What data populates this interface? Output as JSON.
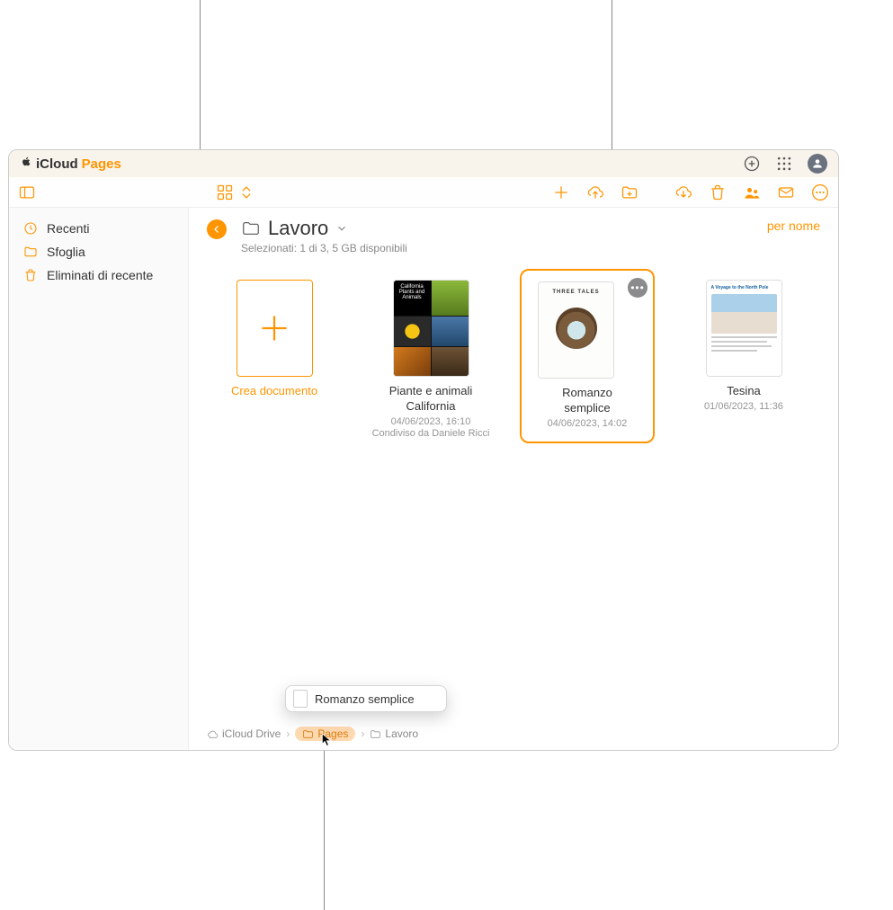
{
  "brand": {
    "icloud": "iCloud",
    "app": "Pages"
  },
  "sidebar": {
    "items": [
      {
        "label": "Recenti"
      },
      {
        "label": "Sfoglia"
      },
      {
        "label": "Eliminati di recente"
      }
    ]
  },
  "header": {
    "folder": "Lavoro",
    "subtitle": "Selezionati: 1 di 3, 5 GB disponibili",
    "sort": "per nome"
  },
  "tiles": {
    "create": "Crea documento",
    "items": [
      {
        "name": "Piante e animali California",
        "date": "04/06/2023, 16:10",
        "shared": "Condiviso da Daniele Ricci",
        "thumb_title": "California Plants and Animals"
      },
      {
        "name": "Romanzo semplice",
        "date": "04/06/2023, 14:02",
        "thumb_title": "THREE TALES"
      },
      {
        "name": "Tesina",
        "date": "01/06/2023, 11:36",
        "thumb_title": "A Voyage to the North Pole"
      }
    ]
  },
  "drag": {
    "label": "Romanzo semplice"
  },
  "breadcrumb": {
    "items": [
      {
        "label": "iCloud Drive"
      },
      {
        "label": "Pages"
      },
      {
        "label": "Lavoro"
      }
    ]
  }
}
